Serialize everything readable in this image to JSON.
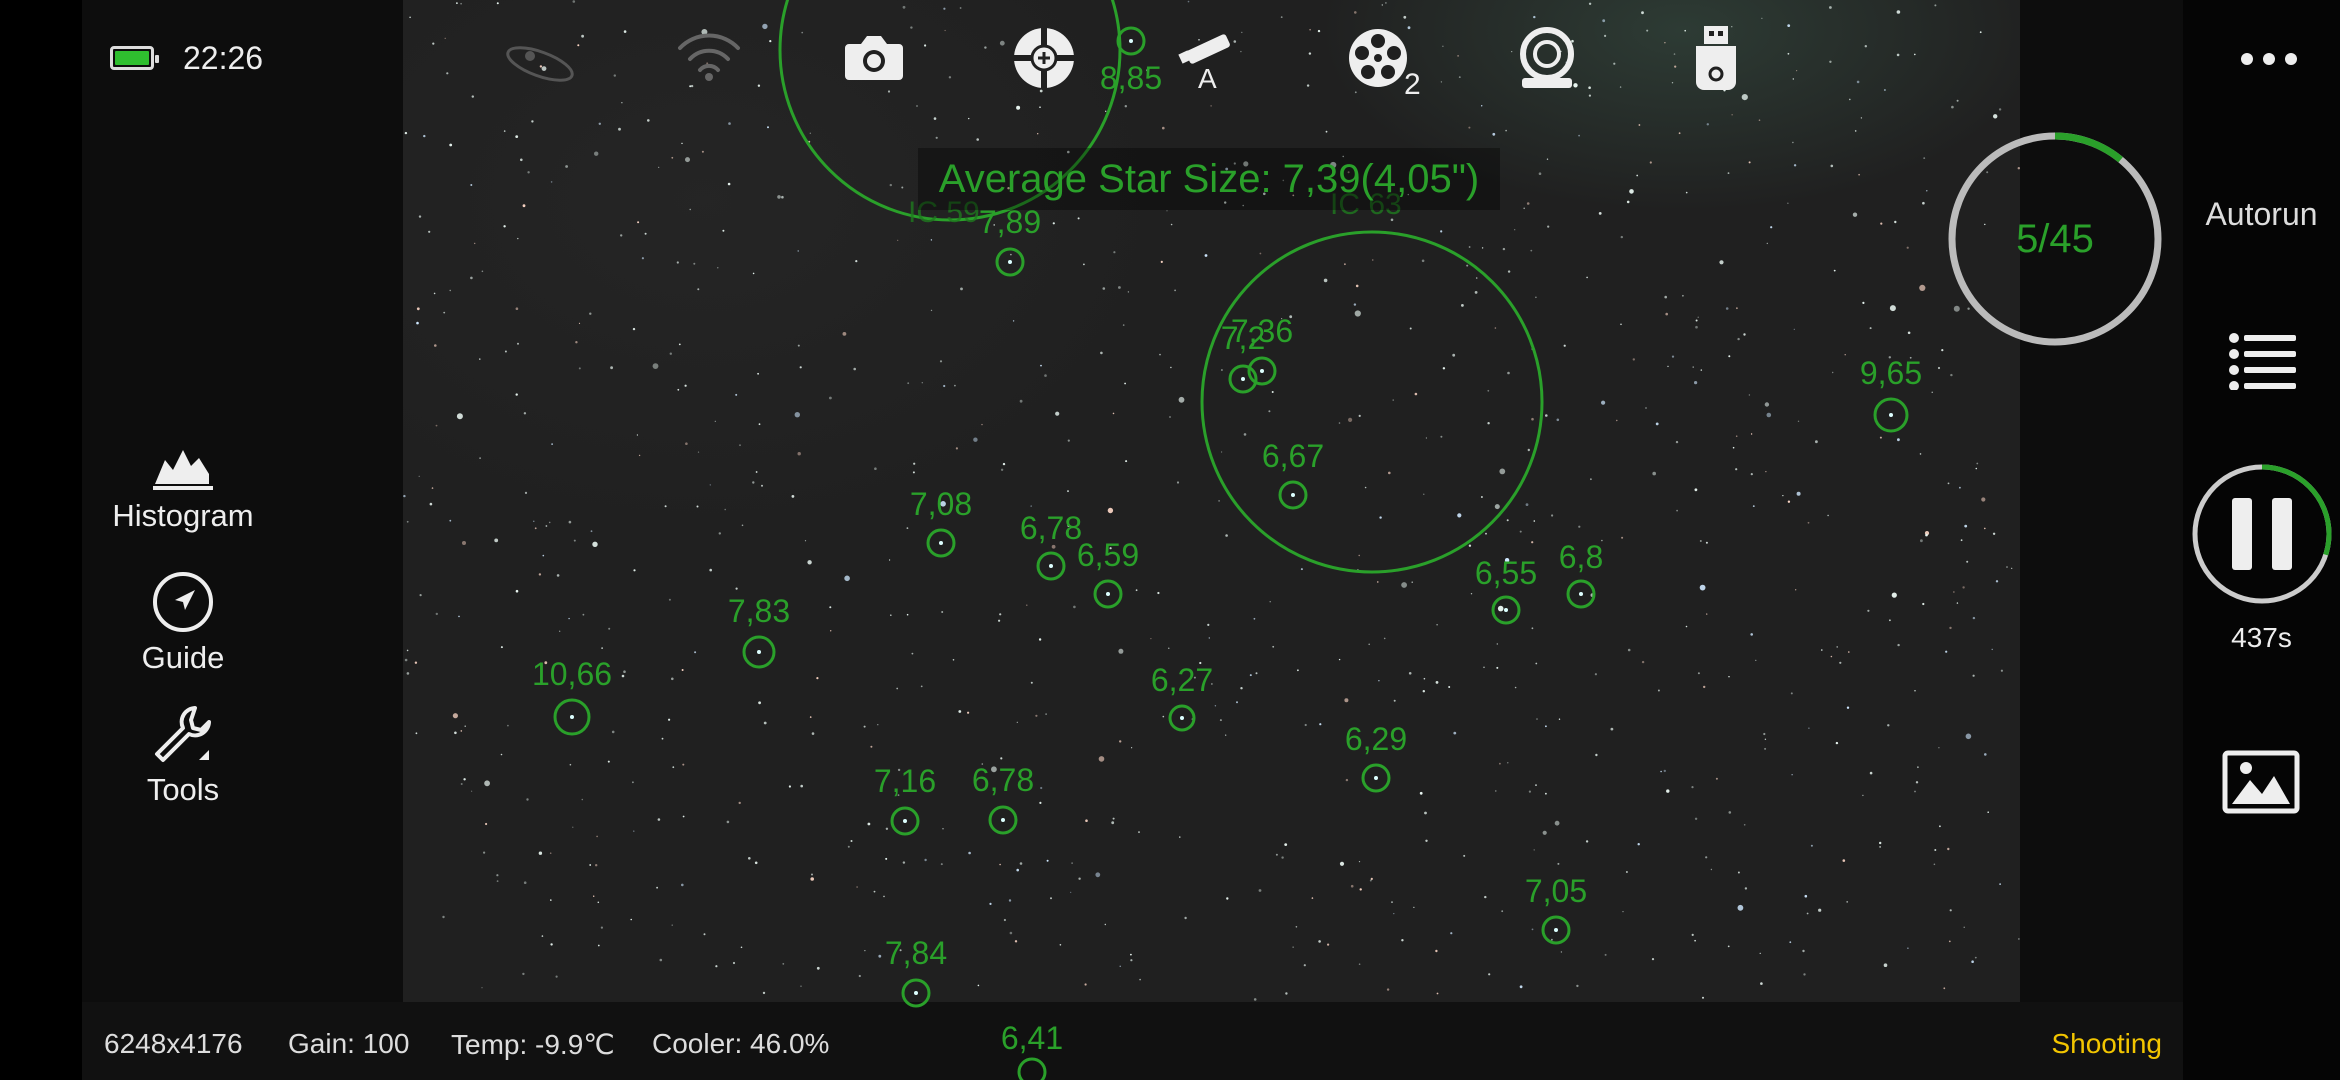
{
  "status": {
    "time": "22:26",
    "battery": "full"
  },
  "left_tools": [
    {
      "label": "Histogram",
      "icon": "histogram-icon"
    },
    {
      "label": "Guide",
      "icon": "guide-icon"
    },
    {
      "label": "Tools",
      "icon": "wrench-icon"
    }
  ],
  "top_bar": {
    "icons": [
      "meridian-icon",
      "wifi-icon",
      "camera-icon",
      "focuser-icon",
      "telescope-icon",
      "filter-wheel-icon",
      "rotator-icon",
      "usb-drive-icon"
    ],
    "telescope_mode": "A",
    "filter_position": "2"
  },
  "overlay": {
    "average_star_size": "Average Star Size: 7,39(4,05\")",
    "objects": [
      "IC 59",
      "IC 63"
    ],
    "stars": [
      "8,85",
      "7,89",
      "7,36",
      "7,2",
      "9,65",
      "6,67",
      "7,08",
      "6,78",
      "6,59",
      "6,55",
      "6,8",
      "7,83",
      "10,66",
      "6,27",
      "6,29",
      "7,16",
      "6,78",
      "7,05",
      "7,84",
      "6,41"
    ]
  },
  "right_panel": {
    "menu": "more-icon",
    "progress": "5/45",
    "progress_fraction": 0.11,
    "autorun_label": "Autorun",
    "pause_timer": "437s",
    "pause_fraction": 0.3
  },
  "bottom_bar": {
    "resolution": "6248x4176",
    "gain": "Gain: 100",
    "temp": "Temp: -9.9℃",
    "cooler": "Cooler: 46.0%",
    "state": "Shooting"
  },
  "colors": {
    "overlay_green": "#2aa02a",
    "status_yellow": "#f2c500"
  }
}
